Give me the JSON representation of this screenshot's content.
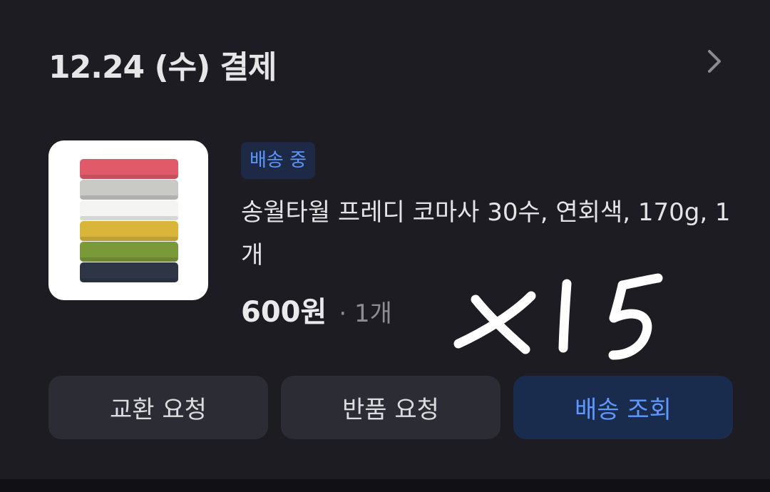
{
  "order": {
    "date_label": "12.24 (수) 결제"
  },
  "product": {
    "status_badge": "배송 중",
    "name": "송월타월 프레디 코마사 30수, 연회색, 170g, 1개",
    "price": "600원",
    "quantity": "· 1개",
    "thumbnail_towel_colors": [
      "#e05a6a",
      "#c9c9c6",
      "#f4f4f2",
      "#d9b53a",
      "#7a9a3a",
      "#2e3646"
    ]
  },
  "annotation": {
    "handwritten_text": "x15"
  },
  "actions": {
    "exchange_label": "교환 요청",
    "return_label": "반품 요청",
    "track_label": "배송 조회"
  },
  "colors": {
    "accent_blue": "#5e97ff",
    "badge_bg": "#1e2a45",
    "track_button_bg": "#1a2c4e",
    "button_bg": "#2c2d34",
    "card_bg": "#1c1c22"
  }
}
